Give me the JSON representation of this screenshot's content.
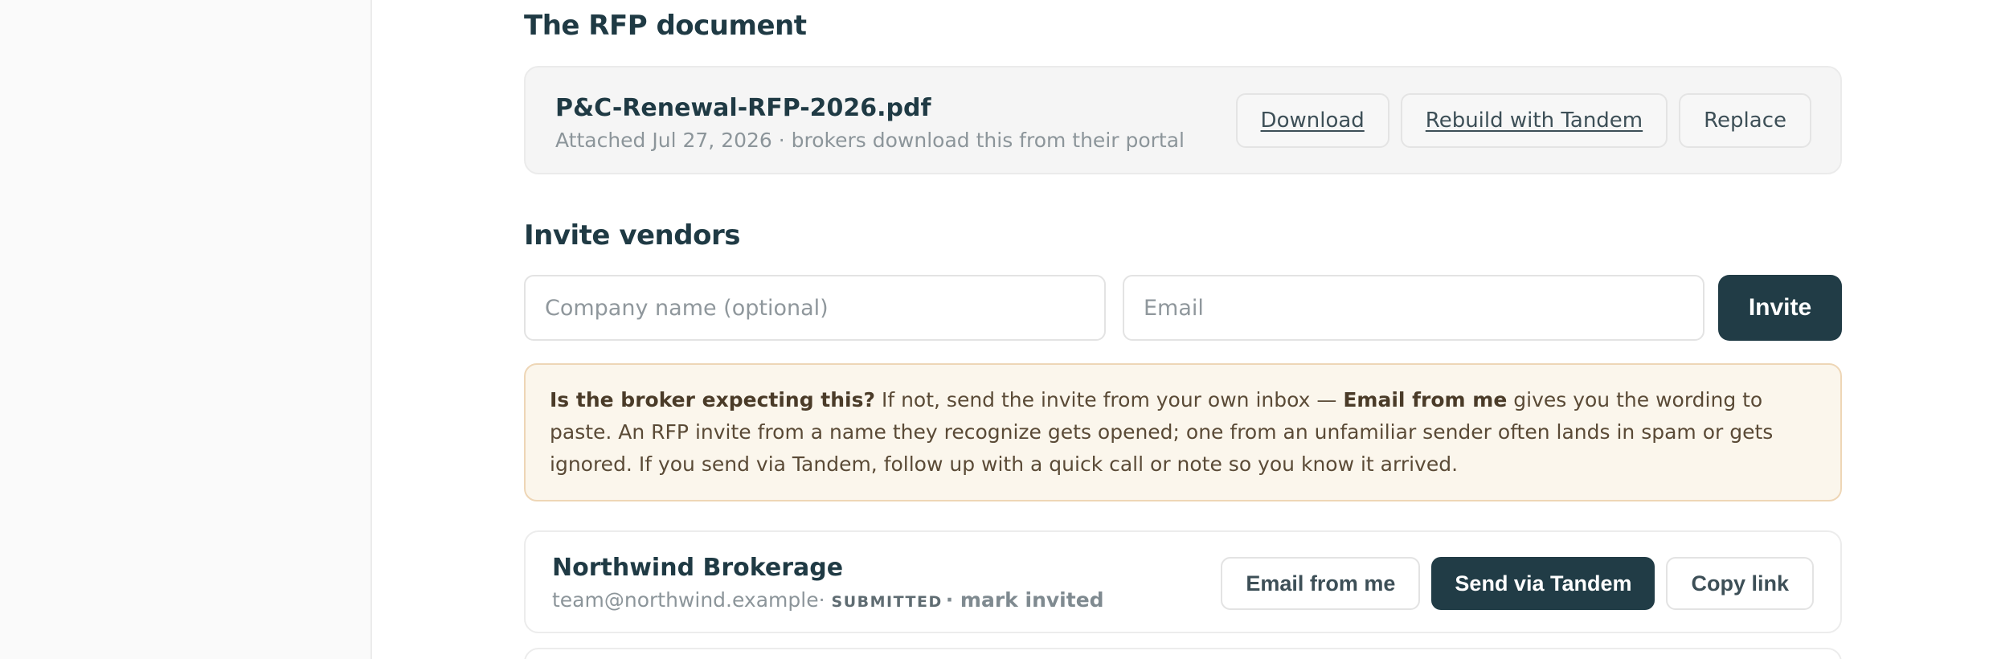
{
  "rfp_section": {
    "title": "The RFP document",
    "document": {
      "name": "P&C-Renewal-RFP-2026.pdf",
      "meta": "Attached Jul 27, 2026 · brokers download this from their portal"
    },
    "actions": {
      "download": "Download",
      "rebuild": "Rebuild with Tandem",
      "replace": "Replace"
    }
  },
  "invite_section": {
    "title": "Invite vendors",
    "company_placeholder": "Company name (optional)",
    "email_placeholder": "Email",
    "invite_label": "Invite",
    "notice": {
      "lead": "Is the broker expecting this?",
      "part1": " If not, send the invite from your own inbox — ",
      "emphasis": "Email from me",
      "part2": " gives you the wording to paste. An RFP invite from a name they recognize gets opened; one from an unfamiliar sender often lands in spam or gets ignored. If you send via Tandem, follow up with a quick call or note so you know it arrived."
    }
  },
  "vendors": [
    {
      "name": "Northwind Brokerage",
      "email": "team@northwind.example",
      "separator": " · ",
      "status": "SUBMITTED",
      "mark_action": "· mark invited",
      "actions": {
        "email_from_me": "Email from me",
        "send_via_tandem": "Send via Tandem",
        "copy_link": "Copy link"
      }
    }
  ]
}
